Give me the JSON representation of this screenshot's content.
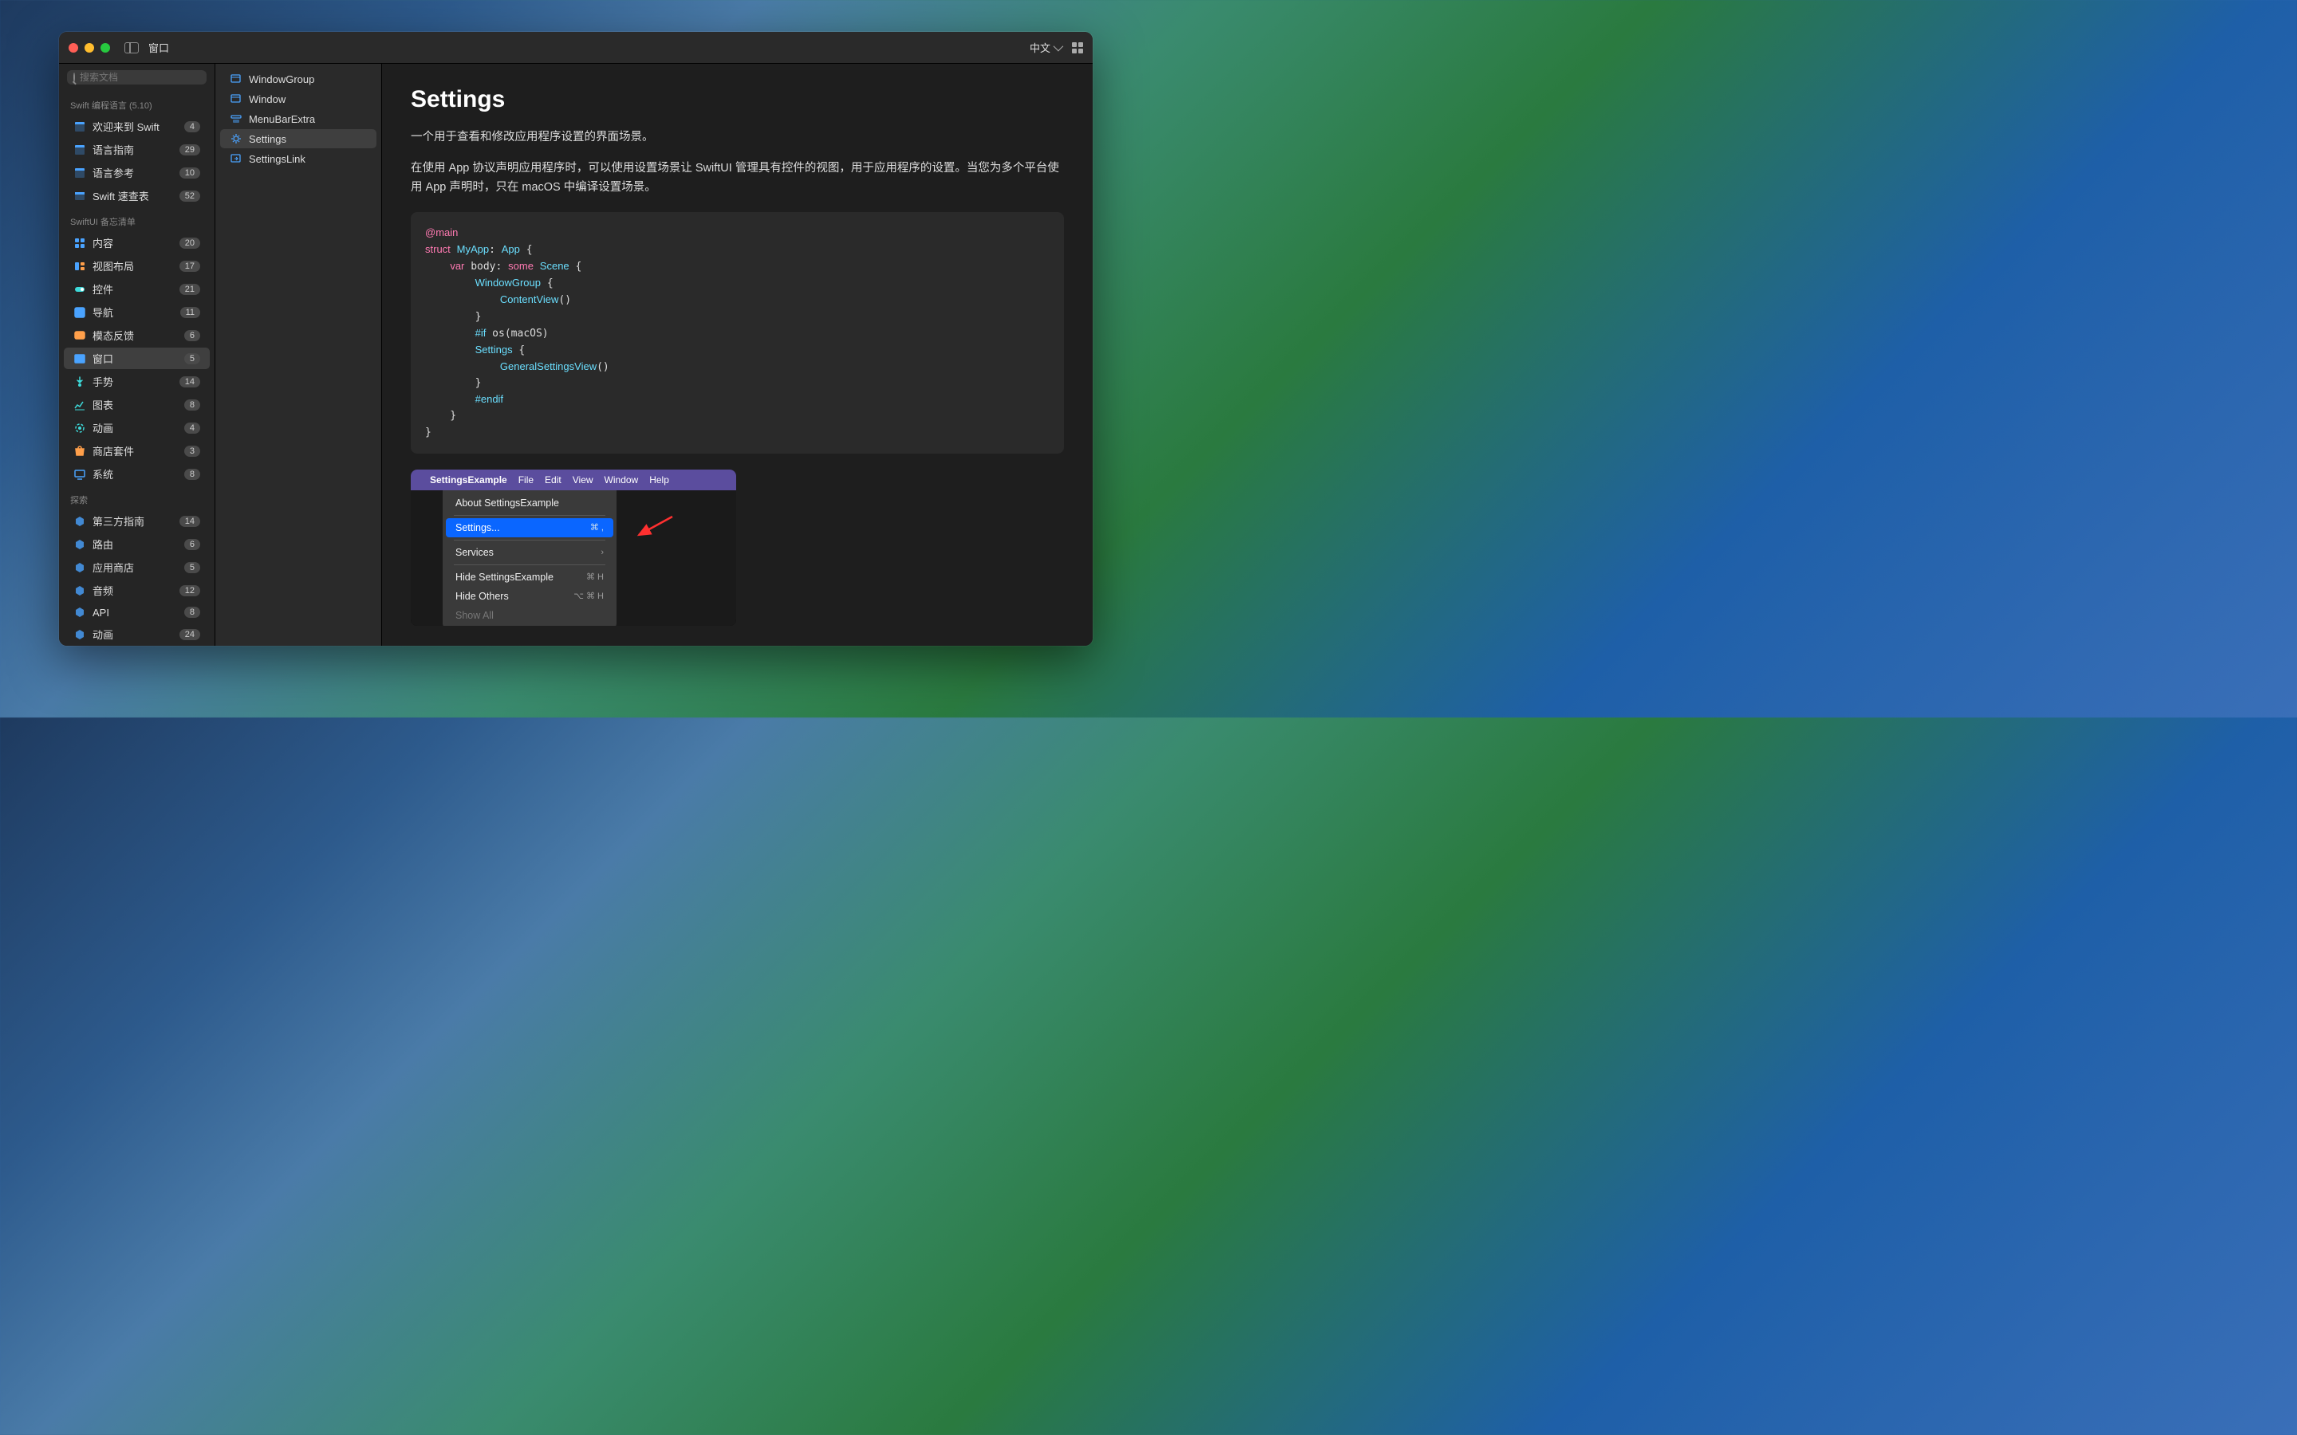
{
  "titlebar": {
    "title": "窗口",
    "lang": "中文"
  },
  "search": {
    "placeholder": "搜索文档"
  },
  "sections": {
    "swift": {
      "header": "Swift 编程语言 (5.10)"
    },
    "swiftui": {
      "header": "SwiftUI 备忘清单"
    },
    "explore": {
      "header": "探索"
    }
  },
  "sidebar": {
    "swift": [
      {
        "label": "欢迎来到 Swift",
        "badge": "4"
      },
      {
        "label": "语言指南",
        "badge": "29"
      },
      {
        "label": "语言参考",
        "badge": "10"
      },
      {
        "label": "Swift 速查表",
        "badge": "52"
      }
    ],
    "swiftui": [
      {
        "label": "内容",
        "badge": "20"
      },
      {
        "label": "视图布局",
        "badge": "17"
      },
      {
        "label": "控件",
        "badge": "21"
      },
      {
        "label": "导航",
        "badge": "11"
      },
      {
        "label": "模态反馈",
        "badge": "6"
      },
      {
        "label": "窗口",
        "badge": "5"
      },
      {
        "label": "手势",
        "badge": "14"
      },
      {
        "label": "图表",
        "badge": "8"
      },
      {
        "label": "动画",
        "badge": "4"
      },
      {
        "label": "商店套件",
        "badge": "3"
      },
      {
        "label": "系统",
        "badge": "8"
      }
    ],
    "explore": [
      {
        "label": "第三方指南",
        "badge": "14"
      },
      {
        "label": "路由",
        "badge": "6"
      },
      {
        "label": "应用商店",
        "badge": "5"
      },
      {
        "label": "音频",
        "badge": "12"
      },
      {
        "label": "API",
        "badge": "8"
      },
      {
        "label": "动画",
        "badge": "24"
      }
    ]
  },
  "mid": [
    {
      "label": "WindowGroup"
    },
    {
      "label": "Window"
    },
    {
      "label": "MenuBarExtra"
    },
    {
      "label": "Settings"
    },
    {
      "label": "SettingsLink"
    }
  ],
  "content": {
    "title": "Settings",
    "p1": "一个用于查看和修改应用程序设置的界面场景。",
    "p2": "在使用 App 协议声明应用程序时，可以使用设置场景让 SwiftUI 管理具有控件的视图，用于应用程序的设置。当您为多个平台使用 App 声明时，只在 macOS 中编译设置场景。"
  },
  "screenshot": {
    "menubar": {
      "app": "SettingsExample",
      "items": [
        "File",
        "Edit",
        "View",
        "Window",
        "Help"
      ]
    },
    "menu": {
      "about": "About SettingsExample",
      "settings": "Settings...",
      "settings_sc": "⌘ ,",
      "services": "Services",
      "hide": "Hide SettingsExample",
      "hide_sc": "⌘ H",
      "hideothers": "Hide Others",
      "hideothers_sc": "⌥ ⌘ H",
      "showall": "Show All"
    }
  }
}
